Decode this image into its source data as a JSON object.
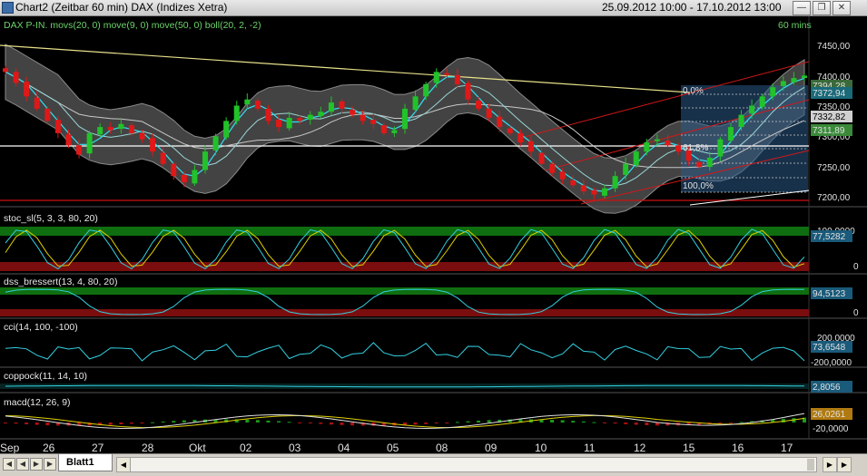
{
  "window": {
    "title": "Chart2 (Zeitbar 60 min)  DAX (Indizes Xetra)",
    "date_range": "25.09.2012 10:00 - 17.10.2012 13:00",
    "min_icon": "minimize-icon",
    "max_icon": "restore-icon",
    "close_icon": "close-icon"
  },
  "main_panel": {
    "header": "DAX P-IN. movs(20, 0) move(9, 0) move(50, 0) boll(20, 2, -2)",
    "interval": "60 mins",
    "y_ticks": [
      "7450,00",
      "7400,00",
      "7350,00",
      "7300,00",
      "7250,00",
      "7200,00"
    ],
    "price_labels": [
      "7394,28",
      "7372,94",
      "7332,82",
      "7311,89"
    ],
    "fib_labels": [
      "0,0%",
      "61,8%",
      "100,0%"
    ]
  },
  "panels": {
    "stoch": {
      "header": "stoc_sl(5, 3, 3, 80, 20)",
      "ticks": [
        "100,0000",
        "0"
      ],
      "value": "77,5282"
    },
    "dss": {
      "header": "dss_bressert(13, 4, 80, 20)",
      "ticks": [
        "0"
      ],
      "value": "94,5123"
    },
    "cci": {
      "header": "cci(14, 100, -100)",
      "ticks": [
        "200,0000",
        "-200,0000"
      ],
      "value": "73,6548"
    },
    "coppock": {
      "header": "coppock(11, 14, 10)",
      "value": "2,8056"
    },
    "macd": {
      "header": "macd(12, 26, 9)",
      "ticks": [
        "-20,0000"
      ],
      "value": "26,0261"
    }
  },
  "x_axis": [
    "Sep",
    "26",
    "27",
    "28",
    "Okt",
    "02",
    "03",
    "04",
    "05",
    "08",
    "09",
    "10",
    "11",
    "12",
    "15",
    "16",
    "17"
  ],
  "bottom_bar": {
    "sheet_tab": "Blatt1",
    "nav_icons": [
      "first-sheet-icon",
      "prev-sheet-icon",
      "next-sheet-icon",
      "last-sheet-icon"
    ]
  },
  "colors": {
    "background": "#000000",
    "bollinger_band": "#606060",
    "candle_up": "#22c22a",
    "candle_down": "#e01818",
    "stoch_k": "#33d0e0",
    "stoch_d": "#e0d000",
    "overbought_band": "#0f6e0f",
    "oversold_band": "#7a0e0e",
    "trendline_red": "#e01010",
    "fib_box": "#3a6a9a"
  },
  "chart_data": {
    "type": "candlestick",
    "symbol": "DAX",
    "interval": "60 mins",
    "ylim": [
      7180,
      7470
    ],
    "last_price": 7394.28,
    "x_labels": [
      "Sep",
      "26",
      "27",
      "28",
      "Okt",
      "02",
      "03",
      "04",
      "05",
      "08",
      "09",
      "10",
      "11",
      "12",
      "15",
      "16",
      "17"
    ],
    "approx_closes": [
      7400,
      7382,
      7360,
      7340,
      7320,
      7300,
      7280,
      7265,
      7300,
      7310,
      7305,
      7315,
      7300,
      7290,
      7270,
      7250,
      7230,
      7220,
      7240,
      7270,
      7295,
      7320,
      7345,
      7355,
      7340,
      7320,
      7310,
      7325,
      7320,
      7330,
      7335,
      7350,
      7340,
      7330,
      7320,
      7315,
      7300,
      7305,
      7340,
      7360,
      7380,
      7400,
      7395,
      7380,
      7355,
      7340,
      7325,
      7310,
      7300,
      7285,
      7270,
      7250,
      7235,
      7225,
      7215,
      7205,
      7200,
      7210,
      7230,
      7250,
      7270,
      7285,
      7290,
      7280,
      7270,
      7255,
      7245,
      7260,
      7290,
      7310,
      7330,
      7345,
      7360,
      7375,
      7385,
      7390,
      7394
    ]
  }
}
